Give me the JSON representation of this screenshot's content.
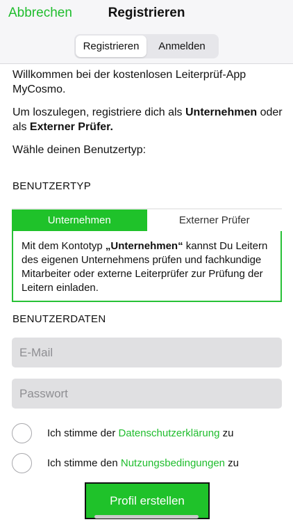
{
  "header": {
    "cancel_label": "Abbrechen",
    "title": "Registrieren",
    "segments": [
      {
        "label": "Registrieren",
        "selected": true
      },
      {
        "label": "Anmelden",
        "selected": false
      }
    ]
  },
  "intro": {
    "welcome": "Willkommen bei der kostenlosen Leiterprüf-App MyCosmo.",
    "start_prefix": "Um loszulegen, registriere dich als ",
    "start_company": "Unternehmen",
    "start_middle": " oder als ",
    "start_inspector": "Externer Prüfer.",
    "choose": "Wähle deinen Benutzertyp:"
  },
  "user_type": {
    "section_label": "BENUTZERTYP",
    "tabs": [
      {
        "label": "Unternehmen",
        "selected": true
      },
      {
        "label": "Externer Prüfer",
        "selected": false
      }
    ],
    "info_prefix": "Mit dem Kontotyp ",
    "info_bold": "„Unternehmen“",
    "info_suffix": " kannst Du Leitern des eigenen Unternehmens prüfen und fachkundige Mitarbeiter oder externe Leiterprüfer zur Prüfung der Leitern einladen."
  },
  "user_data": {
    "section_label": "BENUTZERDATEN",
    "email_placeholder": "E-Mail",
    "email_value": "",
    "password_placeholder": "Passwort",
    "password_value": ""
  },
  "consents": [
    {
      "prefix": "Ich stimme der ",
      "link": "Datenschutzerklärung",
      "suffix": " zu",
      "checked": false
    },
    {
      "prefix": "Ich stimme den ",
      "link": "Nutzungsbedingungen",
      "suffix": " zu",
      "checked": false
    }
  ],
  "submit_label": "Profil erstellen",
  "colors": {
    "accent_green": "#1fc22a",
    "link_green": "#1fbd2d",
    "input_bg": "#e0e0e2",
    "header_bg": "#f6f6f8"
  }
}
